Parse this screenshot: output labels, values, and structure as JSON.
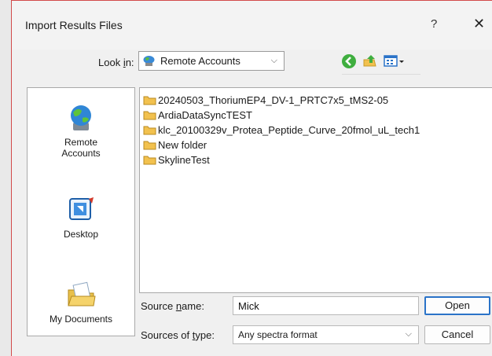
{
  "dialog": {
    "title": "Import Results Files",
    "help": "?",
    "close": "✕"
  },
  "lookin": {
    "label_pre": "Look ",
    "label_key": "i",
    "label_post": "n:",
    "value": "Remote Accounts",
    "arrow": "⌵"
  },
  "places": [
    {
      "label_line1": "Remote",
      "label_line2": "Accounts",
      "icon": "remote-accounts-icon"
    },
    {
      "label_line1": "Desktop",
      "label_line2": "",
      "icon": "desktop-icon"
    },
    {
      "label_line1": "My Documents",
      "label_line2": "",
      "icon": "my-documents-icon"
    }
  ],
  "files": [
    "20240503_ThoriumEP4_DV-1_PRTC7x5_tMS2-05",
    "ArdiaDataSyncTEST",
    "klc_20100329v_Protea_Peptide_Curve_20fmol_uL_tech1",
    "New folder",
    "SkylineTest"
  ],
  "source_name": {
    "label_pre": "Source ",
    "label_key": "n",
    "label_post": "ame:",
    "value": "Mick"
  },
  "source_type": {
    "label_pre": "Sources of ",
    "label_key": "t",
    "label_post": "ype:",
    "value": "Any spectra format",
    "arrow": "⌵"
  },
  "buttons": {
    "open": "Open",
    "cancel": "Cancel"
  },
  "colors": {
    "accent": "#2a73c8",
    "folder": "#f2c14e",
    "title_border": "#d24b4b"
  }
}
